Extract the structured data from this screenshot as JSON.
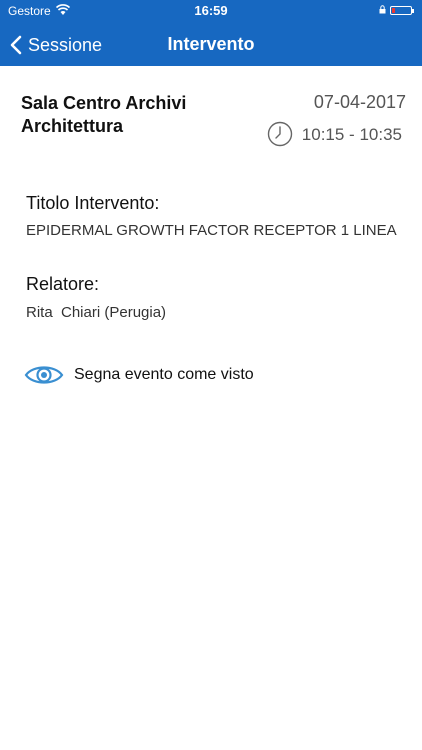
{
  "status_bar": {
    "carrier": "Gestore",
    "time": "16:59"
  },
  "nav": {
    "back_label": "Sessione",
    "title": "Intervento"
  },
  "event": {
    "room": "Sala Centro Archivi Architettura",
    "date": "07-04-2017",
    "time": "10:15 - 10:35"
  },
  "details": {
    "title_label": "Titolo Intervento:",
    "title_value": "EPIDERMAL GROWTH FACTOR RECEPTOR 1 LINEA",
    "speaker_label": "Relatore:",
    "speaker_value": "Rita  Chiari (Perugia)"
  },
  "actions": {
    "mark_seen_label": "Segna evento come visto"
  },
  "colors": {
    "brand": "#1768c1",
    "eye": "#3a8fd1",
    "battery": "#e53935"
  },
  "icons": [
    "wifi-icon",
    "lock-icon",
    "battery-icon",
    "chevron-left-icon",
    "clock-icon",
    "eye-icon"
  ]
}
